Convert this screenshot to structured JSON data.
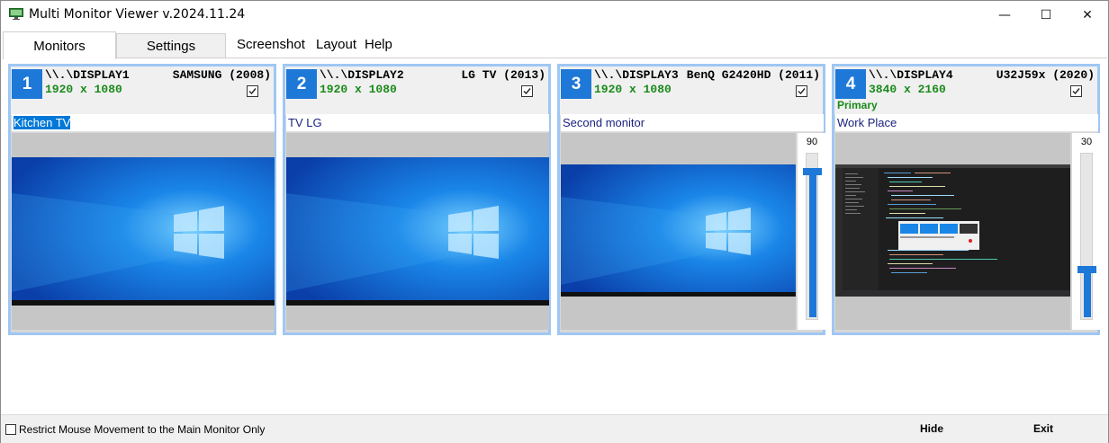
{
  "window": {
    "title": "Multi Monitor Viewer v.2024.11.24",
    "minimize_glyph": "—",
    "maximize_glyph": "☐",
    "close_glyph": "✕"
  },
  "tabs": [
    {
      "label": "Monitors",
      "active": true
    },
    {
      "label": "Settings",
      "active": false
    }
  ],
  "menu": [
    "Screenshot",
    "Layout",
    "Help"
  ],
  "monitors": [
    {
      "number": "1",
      "id": "\\\\.\\DISPLAY1",
      "resolution": "1920 x 1080",
      "model": "SAMSUNG (2008)",
      "checked": true,
      "primary": "",
      "name": "Kitchen TV",
      "name_selected": true,
      "wallpaper": "windows-10-blue",
      "slider": null
    },
    {
      "number": "2",
      "id": "\\\\.\\DISPLAY2",
      "resolution": "1920 x 1080",
      "model": "LG TV (2013)",
      "checked": true,
      "primary": "",
      "name": "TV LG",
      "name_selected": false,
      "wallpaper": "windows-10-blue",
      "slider": null
    },
    {
      "number": "3",
      "id": "\\\\.\\DISPLAY3",
      "resolution": "1920 x 1080",
      "model": "BenQ G2420HD (2011)",
      "checked": true,
      "primary": "",
      "name": "Second monitor",
      "name_selected": false,
      "wallpaper": "windows-10-blue",
      "slider": {
        "value": "90",
        "level": 0.9
      }
    },
    {
      "number": "4",
      "id": "\\\\.\\DISPLAY4",
      "resolution": "3840 x 2160",
      "model": "U32J59x (2020)",
      "checked": true,
      "primary": "Primary",
      "name": "Work Place",
      "name_selected": false,
      "wallpaper": "code-editor-dark",
      "slider": {
        "value": "30",
        "level": 0.3
      }
    }
  ],
  "bottom": {
    "restrict_label": "Restrict Mouse Movement to the Main Monitor Only",
    "restrict_checked": false,
    "hide_label": "Hide",
    "exit_label": "Exit"
  },
  "colors": {
    "accent": "#1e78d7",
    "panel_border": "#9fc7f3",
    "resolution_text": "#1a8a1a",
    "name_text": "#1a237e"
  },
  "icons": {
    "app": "monitor-icon",
    "checkbox": "checkmark-icon"
  }
}
